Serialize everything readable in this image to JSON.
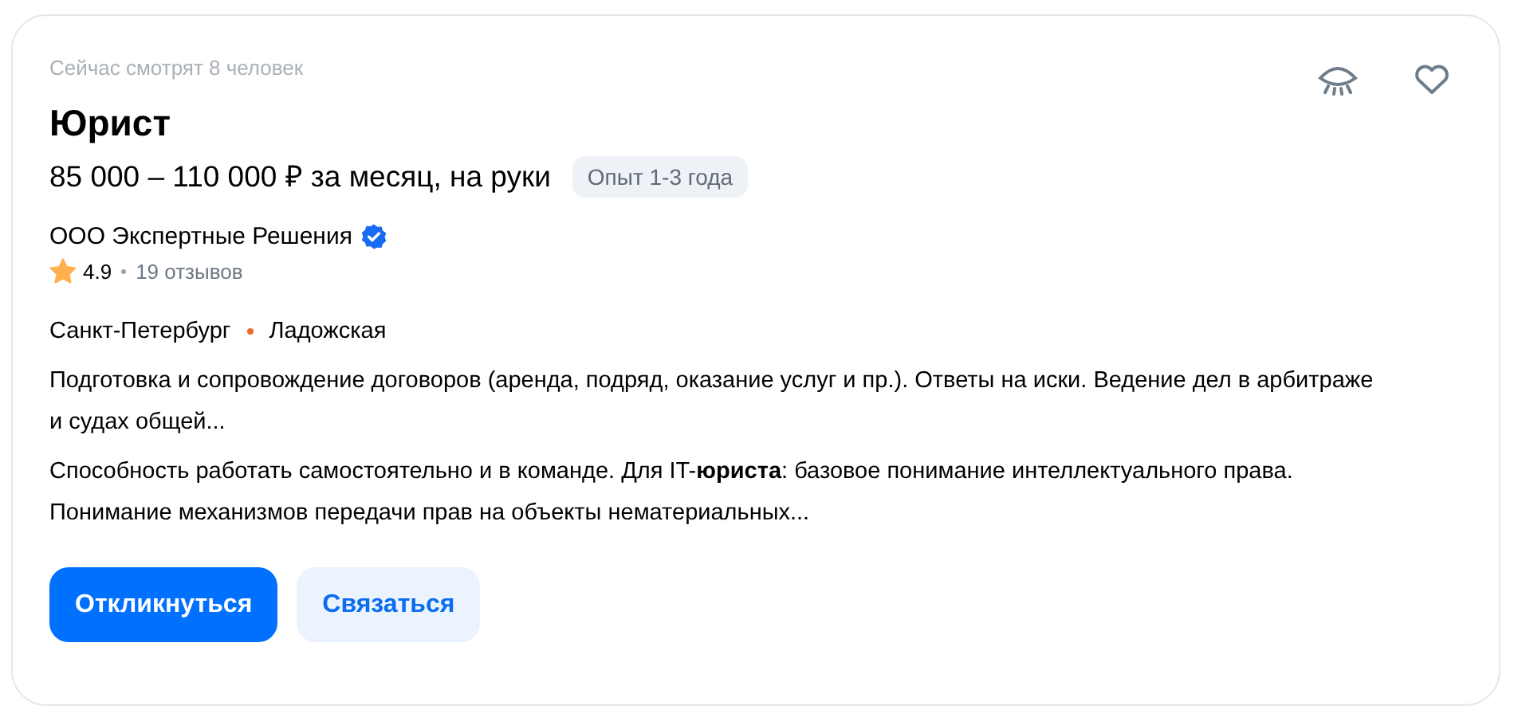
{
  "viewers": "Сейчас смотрят 8 человек",
  "title": "Юрист",
  "salary": "85 000 – 110 000 ₽ за месяц, на руки",
  "experience": "Опыт 1-3 года",
  "company": {
    "name": "ООО Экспертные Решения",
    "verified": true,
    "rating": "4.9",
    "reviews": "19 отзывов"
  },
  "location": {
    "city": "Санкт-Петербург",
    "metro": "Ладожская",
    "color": "#ef6a2c"
  },
  "descriptions": [
    "Подготовка и сопровождение договоров (аренда, подряд, оказание услуг и пр.). Ответы на иски. Ведение дел в арбитраже и судах общей...",
    "Способность работать самостоятельно и в команде. Для IT-**юриста**: базовое понимание интеллектуального права. Понимание механизмов передачи прав на объекты нематериальных..."
  ],
  "buttons": [
    {
      "label": "Откликнуться",
      "kind": "primary"
    },
    {
      "label": "Связаться",
      "kind": "secondary"
    }
  ]
}
